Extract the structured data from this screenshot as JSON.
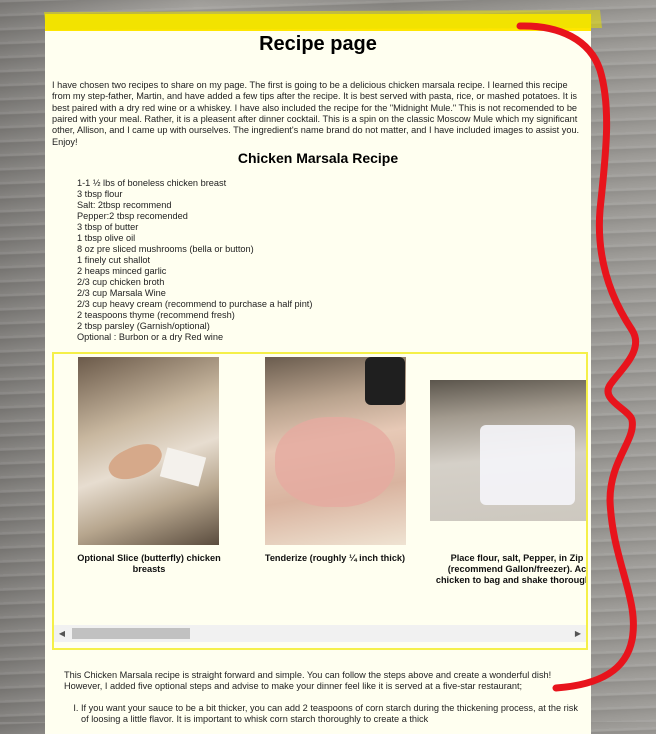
{
  "header": {
    "title": "Recipe page"
  },
  "intro": "I have chosen two recipes to share on my page. The first is going to be a delicious chicken marsala recipe. I learned this recipe from my step-father, Martin, and have added a few tips after the recipe. It is best served with pasta, rice, or mashed potatoes. It is best paired with a dry red wine or a whiskey. I have also included the recipe for the \"Midnight Mule.\" This is not recomended to be paired with your meal. Rather, it is a pleasent after dinner cocktail. This is a spin on the classic Moscow Mule which my significant other, Allison, and I came up with ourselves. The ingredient's name brand do not matter, and I have included images to assist you. Enjoy!",
  "recipe": {
    "title": "Chicken Marsala Recipe",
    "ingredients": [
      "1-1 ½ lbs of boneless chicken breast",
      "3 tbsp flour",
      "Salt: 2tbsp recommend",
      "Pepper:2 tbsp recomended",
      "3 tbsp of butter",
      "1 tbsp olive oil",
      "8 oz pre sliced mushrooms (bella or button)",
      "1 finely cut shallot",
      "2 heaps minced garlic",
      "2/3 cup chicken broth",
      "2/3 cup Marsala Wine",
      "2/3 cup heavy cream (recommend to purchase a half pint)",
      "2 teaspoons thyme (recommend fresh)",
      "2 tbsp parsley (Garnish/optional)",
      "Optional : Burbon or a dry Red wine"
    ]
  },
  "gallery": {
    "captions": [
      "Optional Slice (butterfly) chicken breasts",
      "Tenderize (roughly ¼ inch thick)",
      "Place flour, salt, Pepper, in Zip (recommend Gallon/freezer). Ac chicken to bag and shake thoroughly"
    ],
    "scroll_left": "◀",
    "scroll_right": "▶"
  },
  "after": "This Chicken Marsala recipe is straight forward and simple. You can follow the steps above and create a wonderful dish! However, I added five optional steps and advise to make your dinner feel like it is served at a five-star restaurant;",
  "tips": [
    "If you want your sauce to be a bit thicker, you can add 2 teaspoons of corn starch during the thickening process, at the risk of loosing a little flavor. It is important to whisk corn starch thoroughly to create a thick"
  ],
  "colors": {
    "highlight": "#ffe600",
    "marker": "#e8141c",
    "page_bg": "#fffff0"
  }
}
